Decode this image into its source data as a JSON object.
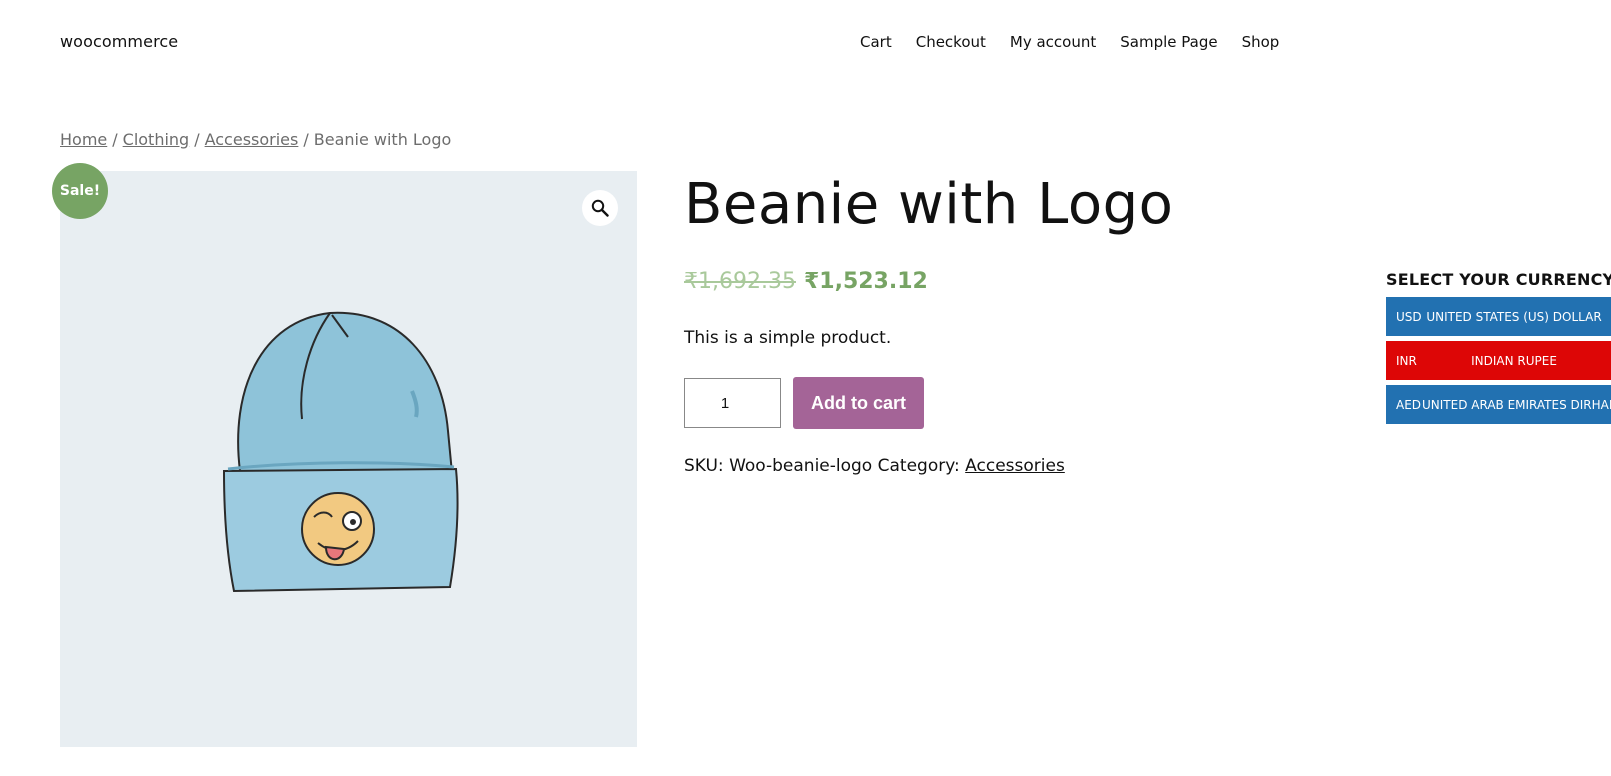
{
  "header": {
    "site_title": "woocommerce",
    "nav": [
      "Cart",
      "Checkout",
      "My account",
      "Sample Page",
      "Shop"
    ]
  },
  "breadcrumb": {
    "home": "Home",
    "clothing": "Clothing",
    "accessories": "Accessories",
    "current": "Beanie with Logo",
    "separator": "/"
  },
  "product": {
    "sale_badge": "Sale!",
    "zoom_icon": "magnifier-icon",
    "title": "Beanie with Logo",
    "regular_price": "₹1,692.35",
    "sale_price": "₹1,523.12",
    "short_description": "This is a simple product.",
    "quantity": "1",
    "add_to_cart_label": "Add to cart",
    "sku_label": "SKU:",
    "sku": "Woo-beanie-logo",
    "category_label": "Category:",
    "category": "Accessories"
  },
  "currency_switcher": {
    "title": "SELECT YOUR CURRENCY",
    "options": [
      {
        "code": "USD",
        "name": "UNITED STATES (US) DOLLAR",
        "color": "#2271b1"
      },
      {
        "code": "INR",
        "name": "INDIAN RUPEE",
        "color": "#dd0606"
      },
      {
        "code": "AED",
        "name": "UNITED ARAB EMIRATES DIRHAM",
        "color": "#2271b1"
      }
    ]
  },
  "colors": {
    "sale_green": "#77a464",
    "button_purple": "#a46497",
    "gallery_bg": "#e8eef2"
  }
}
